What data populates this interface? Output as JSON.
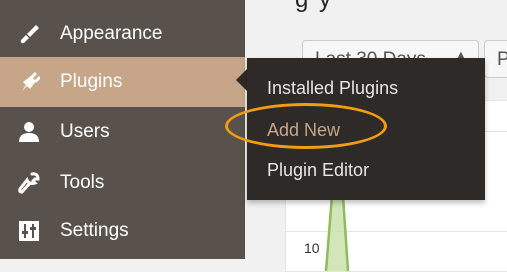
{
  "sidebar": {
    "items": [
      {
        "label": "Appearance",
        "icon": "paintbrush-icon"
      },
      {
        "label": "Plugins",
        "icon": "plug-icon"
      },
      {
        "label": "Users",
        "icon": "user-icon"
      },
      {
        "label": "Tools",
        "icon": "wrench-icon"
      },
      {
        "label": "Settings",
        "icon": "sliders-icon"
      }
    ],
    "active_index": 1
  },
  "flyout": {
    "items": [
      {
        "label": "Installed Plugins"
      },
      {
        "label": "Add New"
      },
      {
        "label": "Plugin Editor"
      }
    ]
  },
  "main": {
    "heading_fragment": "g   y",
    "date_range_select": "Last 30 Days",
    "second_select": "P",
    "chart_axis_tick": "10"
  },
  "colors": {
    "sidebar_bg": "#59524c",
    "active_bg": "#c7a589",
    "flyout_bg": "#2d2a27",
    "accent_text": "#c7a589",
    "highlight_ring": "#f39c12",
    "chart_line": "#8fbc5a"
  }
}
